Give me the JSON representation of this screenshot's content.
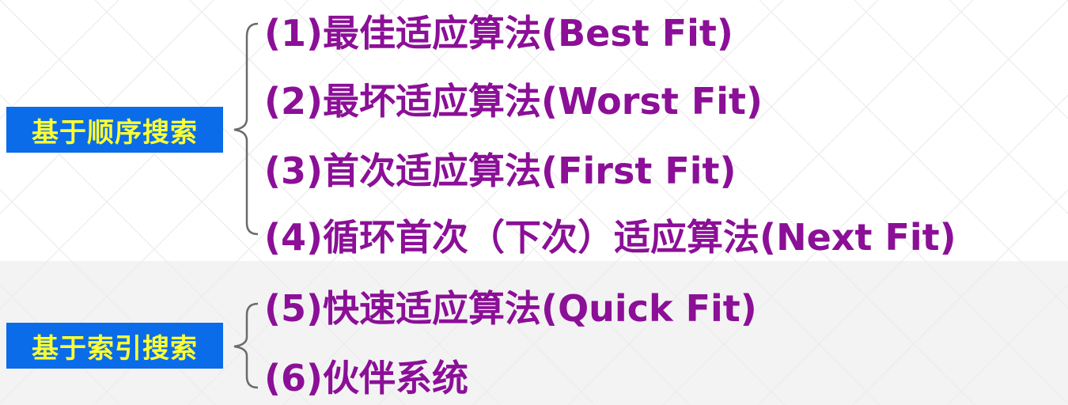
{
  "groups": [
    {
      "label": "基于顺序搜索",
      "items": [
        "(1)最佳适应算法(Best Fit)",
        "(2)最坏适应算法(Worst Fit)",
        "(3)首次适应算法(First Fit)",
        "(4)循环首次（下次）适应算法(Next Fit)"
      ]
    },
    {
      "label": "基于索引搜索",
      "items": [
        "(5)快速适应算法(Quick Fit)",
        "(6)伙伴系统"
      ]
    }
  ],
  "colors": {
    "label_background": "#0a6ce8",
    "label_text": "#ffff33",
    "item_text": "#8b0f97",
    "brace": "#6a6a6a"
  }
}
